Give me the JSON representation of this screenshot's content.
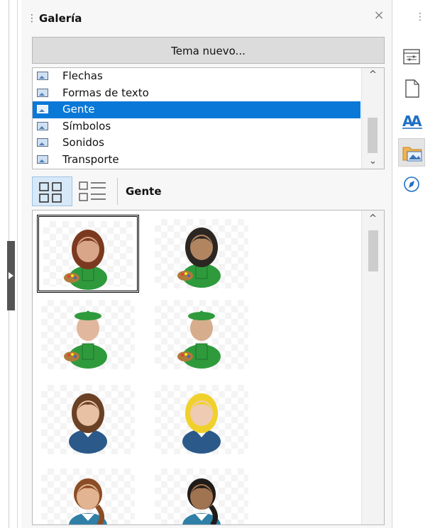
{
  "panel": {
    "title": "Galería",
    "close_glyph": "×",
    "grip_glyph": "⋮"
  },
  "new_theme_button": "Tema nuevo...",
  "themes": {
    "items": [
      {
        "label": "Flechas",
        "selected": false
      },
      {
        "label": "Formas de texto",
        "selected": false
      },
      {
        "label": "Gente",
        "selected": true
      },
      {
        "label": "Símbolos",
        "selected": false
      },
      {
        "label": "Sonidos",
        "selected": false
      },
      {
        "label": "Transporte",
        "selected": false
      }
    ],
    "scroll_up": "^",
    "scroll_down": "⌄"
  },
  "view": {
    "icon_view_active": true,
    "current_theme": "Gente"
  },
  "gallery": {
    "scroll_up": "^",
    "items": [
      {
        "name": "painter-brown-hair-woman",
        "hair": "#7b3a1f",
        "skin": "#d9a68a",
        "clothes": "#2f9a3c",
        "selected": true
      },
      {
        "name": "painter-dark-hair-woman",
        "hair": "#2c2622",
        "skin": "#b08560",
        "clothes": "#2f9a3c",
        "selected": false
      },
      {
        "name": "painter-beret-light",
        "hair": "#2f9a3c",
        "skin": "#e1b79e",
        "clothes": "#2f9a3c",
        "selected": false
      },
      {
        "name": "painter-beret-medium",
        "hair": "#2f9a3c",
        "skin": "#d6ad8d",
        "clothes": "#2f9a3c",
        "selected": false
      },
      {
        "name": "woman-brown-hair-vest",
        "hair": "#6b4126",
        "skin": "#e8c0a4",
        "clothes": "#2b5a8a",
        "selected": false
      },
      {
        "name": "woman-blonde-vest",
        "hair": "#f0d12b",
        "skin": "#efcbb3",
        "clothes": "#2b5a8a",
        "selected": false
      },
      {
        "name": "woman-brown-ponytail",
        "hair": "#8b4d25",
        "skin": "#e3b491",
        "clothes": "#2f7fa6",
        "selected": false
      },
      {
        "name": "woman-dark-ponytail",
        "hair": "#1f1b19",
        "skin": "#a07351",
        "clothes": "#2f7fa6",
        "selected": false
      }
    ]
  },
  "sidebar_tabs": [
    {
      "name": "properties-tab",
      "active": false
    },
    {
      "name": "page-tab",
      "active": false
    },
    {
      "name": "styles-tab",
      "active": false
    },
    {
      "name": "gallery-tab",
      "active": true
    },
    {
      "name": "navigator-tab",
      "active": false
    }
  ],
  "colors": {
    "selection": "#0a78d7",
    "accent_blue": "#1f6fc4"
  }
}
